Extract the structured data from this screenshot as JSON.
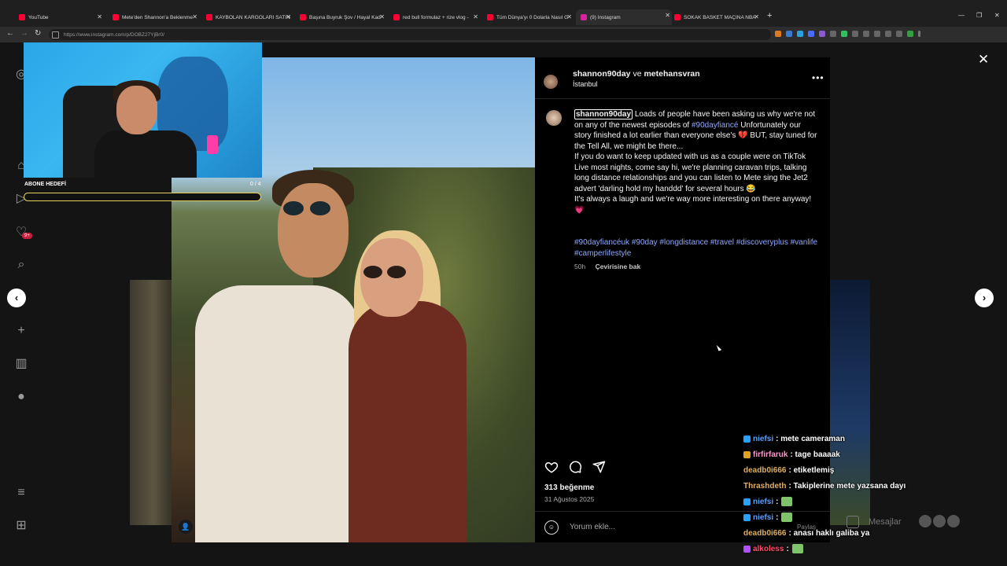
{
  "browser": {
    "tabs": [
      {
        "title": "YouTube",
        "active": false
      },
      {
        "title": "Mete'den Shannon'a Beklenme",
        "active": false
      },
      {
        "title": "KAYBOLAN KARGOLARI SATIN",
        "active": false
      },
      {
        "title": "Başına Buyruk Şov / Hayal Kad",
        "active": false
      },
      {
        "title": "red bull formulaz + rize vlog -",
        "active": false
      },
      {
        "title": "Tüm Dünya'yı 0 Dolarla Nasıl G",
        "active": false
      },
      {
        "title": "(9) Instagram",
        "active": true
      },
      {
        "title": "SOKAK BASKET MAÇINA NBA",
        "active": false
      }
    ],
    "url": "https://www.instagram.com/p/DOBZ27YjBr0/"
  },
  "sidebar": {
    "notification_badge": "9+"
  },
  "stream_overlay": {
    "goal_label": "ABONE HEDEFİ",
    "goal_count": "0 / 4",
    "goal_progress": 0
  },
  "post": {
    "header_user": "shannon90day",
    "header_connector": "ve",
    "header_collab": "metehansvran",
    "location": "İstanbul",
    "caption_user": "shannon90day",
    "caption_part1": "Loads of people have been asking us why we're not on any of the newest episodes of",
    "caption_tag": "#90dayfiancé",
    "caption_part2": "Unfortunately our story finished a lot earlier than everyone else's 💔 BUT, stay tuned for the Tell All, we might be there...",
    "caption_para2": "If you do want to keep updated with us as a couple were on TikTok Live most nights, come say hi, we're planning caravan trips, talking long distance relationships and you can listen to Mete sing the Jet2 advert 'darling hold my handdd' for several hours 😂",
    "caption_para3": "It's always a laugh and we're way more interesting on there anyway! 💗",
    "hashtags": "#90dayfiancéuk #90day #longdistance #travel #discoveryplus #vanlife #camperlifestyle",
    "age": "50h",
    "translate_label": "Çevirisine bak",
    "likes": "313 beğenme",
    "date": "31 Ağustos 2025",
    "comment_placeholder": "Yorum ekle...",
    "more_label": "•••"
  },
  "chat": [
    {
      "user": "niefsi",
      "message": ": mete cameraman",
      "color": "#5aa0ff",
      "badge": "#2aa0ff",
      "emote": false
    },
    {
      "user": "firfirfaruk",
      "message": ": tage baaaak",
      "color": "#ff9ad0",
      "badge": "#e0a020",
      "emote": false
    },
    {
      "user": "deadb0i666",
      "message": ": etiketlemiş",
      "color": "#e0b060",
      "badge": "",
      "emote": false
    },
    {
      "user": "Thrashdeth",
      "message": ": Takiplerine mete yazsana dayı",
      "color": "#e0b060",
      "badge": "",
      "emote": false
    },
    {
      "user": "niefsi",
      "message": ":",
      "color": "#5aa0ff",
      "badge": "#2aa0ff",
      "emote": true
    },
    {
      "user": "niefsi",
      "message": ":",
      "color": "#5aa0ff",
      "badge": "#2aa0ff",
      "emote": true
    },
    {
      "user": "deadb0i666",
      "message": ": anası haklı galiba ya",
      "color": "#e0b060",
      "badge": "",
      "emote": false
    },
    {
      "user": "alkoless",
      "message": ":",
      "color": "#ff4d6a",
      "badge": "#b050ff",
      "emote": true
    }
  ],
  "dm_widget": {
    "label": "Mesajlar",
    "share_label": "Paylaş"
  },
  "colors": {
    "accent_link": "#8fa8ff",
    "panel_bg": "#000000",
    "goal_bar": "#e8d25a"
  }
}
